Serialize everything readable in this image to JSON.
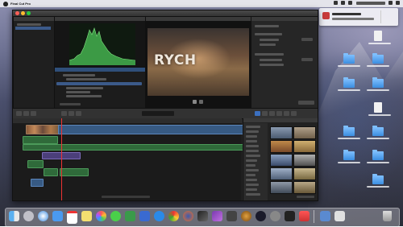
{
  "menubar": {
    "app_name": "Final Cut Pro",
    "items": [
      "",
      "",
      "",
      "",
      "",
      "",
      "",
      ""
    ]
  },
  "window": {
    "title": ""
  },
  "library": {
    "header": "",
    "items": [
      "",
      ""
    ]
  },
  "browser": {
    "header": "",
    "list_items": [
      "",
      "",
      "",
      "",
      "",
      ""
    ],
    "footer": ""
  },
  "viewer": {
    "header": "",
    "video_title_text": "RYCH"
  },
  "inspector": {
    "header": "",
    "section_labels": [
      "",
      "",
      ""
    ],
    "param_labels": [
      "",
      "",
      "",
      ""
    ]
  },
  "timeline": {
    "header": "",
    "footer": "",
    "clip_labels": [
      "",
      ""
    ]
  },
  "effects": {
    "header": "",
    "categories": [
      "",
      "",
      "",
      "",
      "",
      "",
      "",
      "",
      "",
      "",
      "",
      "",
      "",
      "",
      ""
    ],
    "footer": ""
  },
  "notification": {
    "title": "",
    "subtitle": ""
  },
  "desktop_icons": [
    {
      "label": "",
      "kind": "doc"
    },
    {
      "label": "",
      "kind": "folder"
    },
    {
      "label": "",
      "kind": "folder"
    },
    {
      "label": "",
      "kind": "folder"
    },
    {
      "label": "",
      "kind": "folder"
    },
    {
      "label": "",
      "kind": "doc"
    },
    {
      "label": "",
      "kind": "folder"
    },
    {
      "label": "",
      "kind": "folder"
    },
    {
      "label": "",
      "kind": "folder"
    },
    {
      "label": "",
      "kind": "folder"
    },
    {
      "label": "",
      "kind": "folder"
    }
  ],
  "dock": {
    "apps": [
      {
        "name": "finder-icon"
      },
      {
        "name": "launchpad-icon"
      },
      {
        "name": "safari-icon"
      },
      {
        "name": "mail-icon"
      },
      {
        "name": "calendar-icon"
      },
      {
        "name": "notes-icon"
      },
      {
        "name": "photos-icon"
      },
      {
        "name": "messages-icon"
      },
      {
        "name": "numbers-icon"
      },
      {
        "name": "keynote-icon"
      },
      {
        "name": "app-store-icon"
      },
      {
        "name": "chrome-icon"
      },
      {
        "name": "firefox-icon"
      },
      {
        "name": "final-cut-pro-icon"
      },
      {
        "name": "motion-icon"
      },
      {
        "name": "compressor-icon"
      },
      {
        "name": "lion-app-icon"
      },
      {
        "name": "steam-icon"
      },
      {
        "name": "system-prefs-icon"
      },
      {
        "name": "unity-icon"
      },
      {
        "name": "music-icon"
      },
      {
        "name": "downloads-icon"
      },
      {
        "name": "documents-stack-icon"
      },
      {
        "name": "trash-icon"
      }
    ]
  },
  "colors": {
    "selection": "#3b5a8a",
    "playhead": "#ee3333",
    "video_clip": "#375a83",
    "audio_clip": "#2f6a3a",
    "title_clip": "#4b3f7a"
  }
}
